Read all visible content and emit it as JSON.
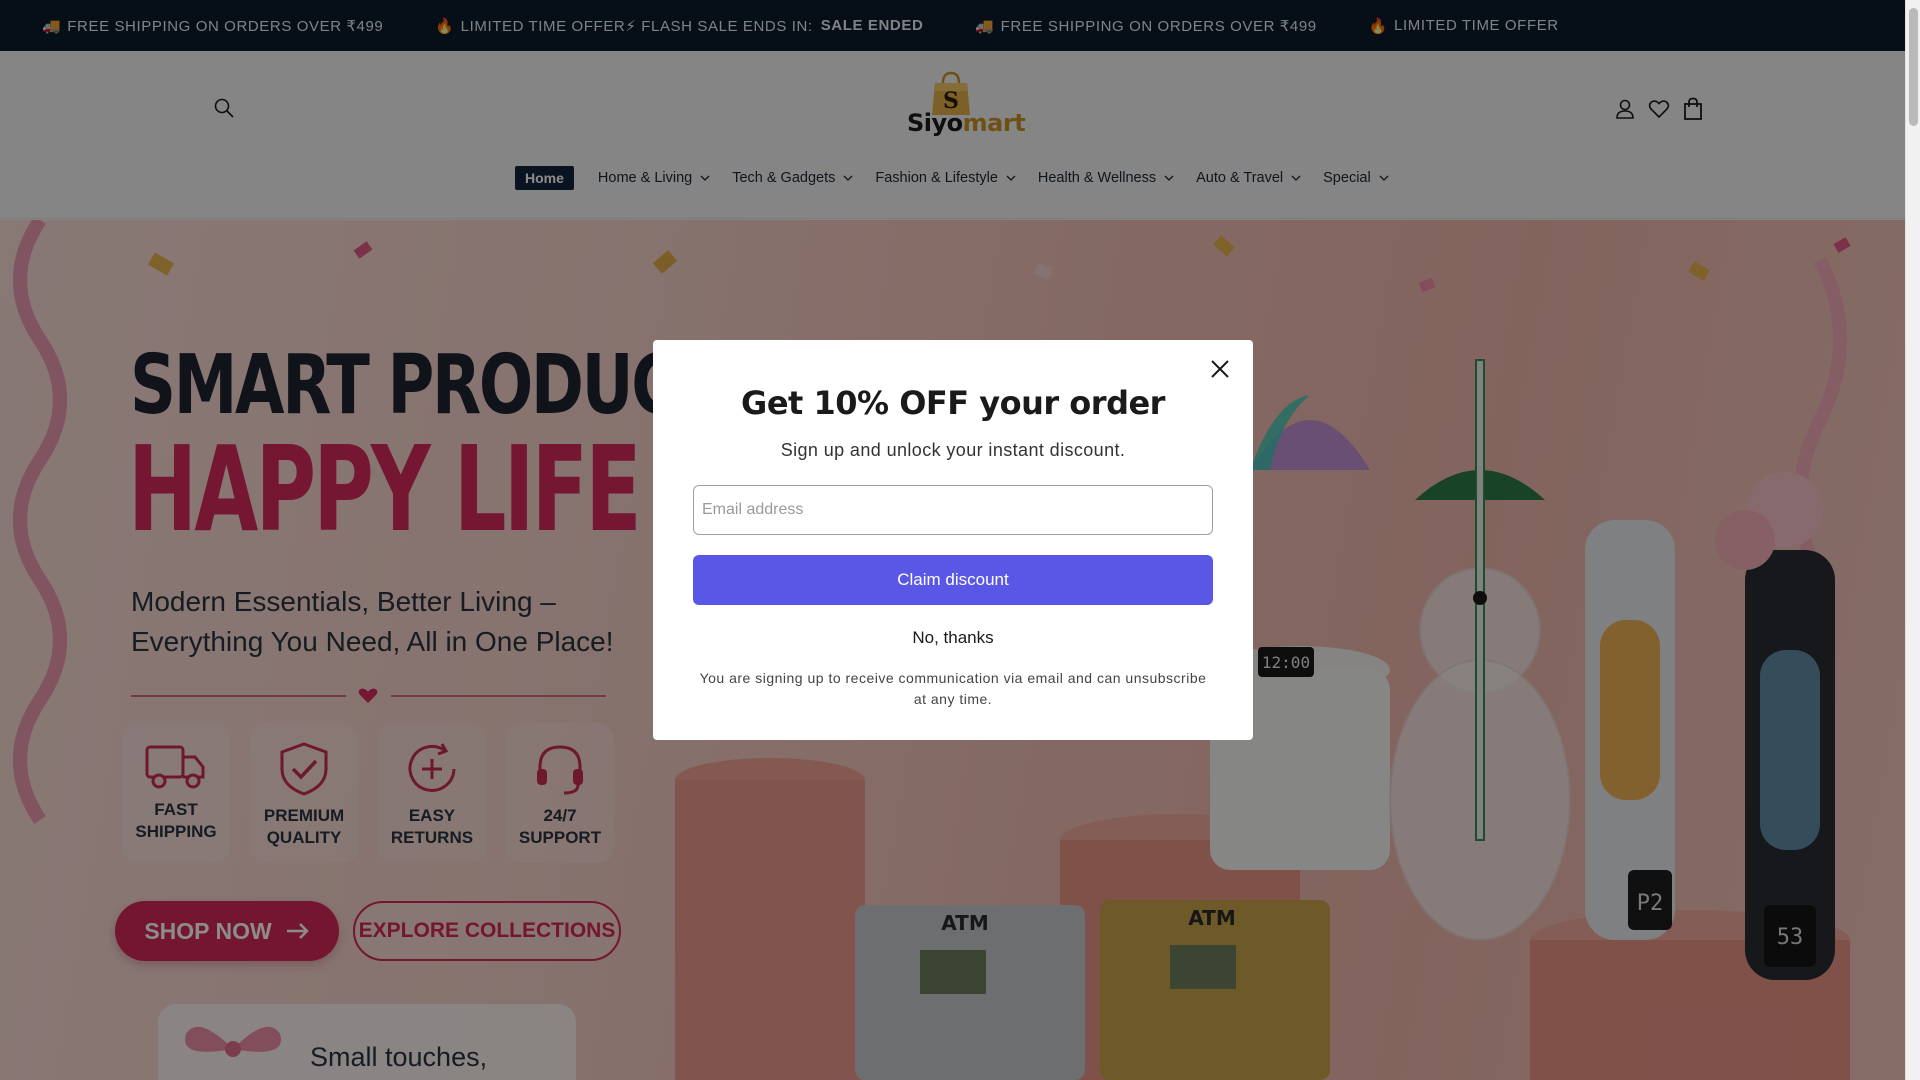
{
  "announcement": {
    "messages": [
      {
        "emoji": "🚚",
        "text": "FREE SHIPPING ON ORDERS OVER ₹499"
      },
      {
        "emoji": "🔥",
        "text": "LIMITED TIME OFFER⚡ FLASH SALE ENDS IN:",
        "strong": "SALE ENDED"
      },
      {
        "emoji": "🚚",
        "text": "FREE SHIPPING ON ORDERS OVER ₹499"
      },
      {
        "emoji": "🔥",
        "text": "LIMITED TIME OFFER"
      }
    ]
  },
  "header": {
    "logo": {
      "prefix": "Siyo",
      "accent": "mart",
      "bag_letter": "S"
    },
    "nav": [
      {
        "label": "Home",
        "active": true
      },
      {
        "label": "Home & Living",
        "dropdown": true
      },
      {
        "label": "Tech & Gadgets",
        "dropdown": true
      },
      {
        "label": "Fashion & Lifestyle",
        "dropdown": true
      },
      {
        "label": "Health & Wellness",
        "dropdown": true
      },
      {
        "label": "Auto & Travel",
        "dropdown": true
      },
      {
        "label": "Special",
        "dropdown": true
      }
    ],
    "icons": [
      "search-icon",
      "account-icon",
      "wishlist-icon",
      "cart-icon"
    ]
  },
  "hero": {
    "title_line1": "SMART PRODUCTS",
    "title_line2": "HAPPY LIFE",
    "subtitle": "Modern Essentials, Better Living – Everything You Need, All in One Place!",
    "features": [
      {
        "icon": "truck-icon",
        "line1": "FAST",
        "line2": "SHIPPING"
      },
      {
        "icon": "shield-check-icon",
        "line1": "PREMIUM",
        "line2": "QUALITY"
      },
      {
        "icon": "returns-icon",
        "line1": "EASY",
        "line2": "RETURNS"
      },
      {
        "icon": "headset-icon",
        "line1": "24/7",
        "line2": "SUPPORT"
      }
    ],
    "primary_cta": "SHOP NOW",
    "secondary_cta": "EXPLORE COLLECTIONS",
    "card_text": "Small touches,"
  },
  "popup": {
    "title": "Get 10% OFF your order",
    "subtitle": "Sign up and unlock your instant discount.",
    "email_placeholder": "Email address",
    "claim_label": "Claim discount",
    "decline_label": "No, thanks",
    "fine_print": "You are signing up to receive communication via email and can unsubscribe at any time."
  },
  "colors": {
    "announcement_bg": "#0b1a2b",
    "brand_pink": "#d5285a",
    "claim_button": "#5a57e6",
    "nav_active": "#13263d"
  }
}
